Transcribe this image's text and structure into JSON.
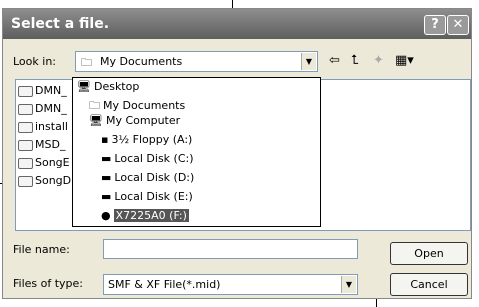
{
  "title": "Select a file.",
  "titlebar_buttons": {
    "help": "?",
    "close": "✕"
  },
  "look_in": {
    "label": "Look in:",
    "value": "My Documents"
  },
  "toolbar": {
    "back": "⇦",
    "up": "⮤",
    "new_folder": "✦",
    "views": "▦▾"
  },
  "file_list": [
    "DMN_",
    "DMN_",
    "install",
    "MSD_",
    "SongE",
    "SongD"
  ],
  "look_in_dropdown": [
    {
      "label": "Desktop",
      "icon": "desktop-icon"
    },
    {
      "label": "My Documents",
      "icon": "documents-icon"
    },
    {
      "label": "My Computer",
      "icon": "computer-icon"
    },
    {
      "label": "3½ Floppy (A:)",
      "icon": "floppy-icon"
    },
    {
      "label": "Local Disk (C:)",
      "icon": "disk-icon"
    },
    {
      "label": "Local Disk (D:)",
      "icon": "disk-icon"
    },
    {
      "label": "Local Disk (E:)",
      "icon": "disk-icon"
    },
    {
      "label": "X7225A0 (F:)",
      "icon": "removable-drive-icon",
      "selected": true
    }
  ],
  "file_name": {
    "label": "File name:",
    "value": ""
  },
  "files_of_type": {
    "label": "Files of type:",
    "value": "SMF & XF File(*.mid)"
  },
  "buttons": {
    "open": "Open",
    "cancel": "Cancel"
  }
}
